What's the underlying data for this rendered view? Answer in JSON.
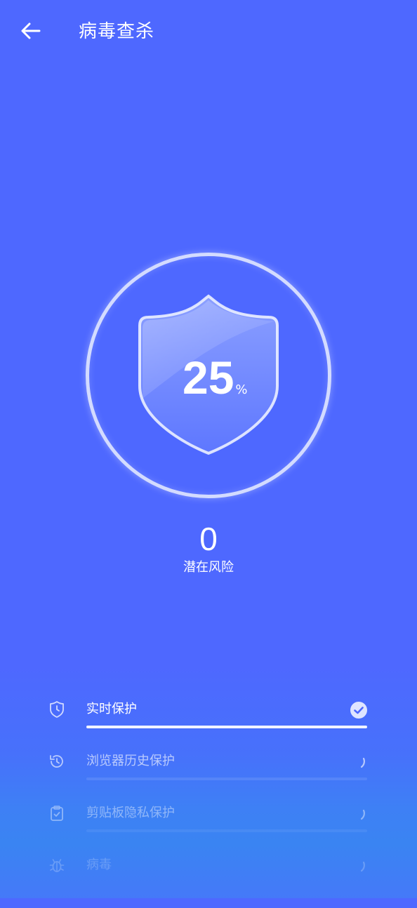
{
  "header": {
    "title": "病毒查杀",
    "back_icon": "arrow-left-icon"
  },
  "scan": {
    "progress": 25,
    "progress_value": "25",
    "unit": "%"
  },
  "risk": {
    "count": "0",
    "label": "潜在风险"
  },
  "colors": {
    "background": "#4e68ff",
    "accent": "#ffffff"
  },
  "items": [
    {
      "label": "实时保护",
      "icon": "clock-shield-icon",
      "status": "done",
      "status_icon": "check-circle-icon",
      "progress": 1.0
    },
    {
      "label": "浏览器历史保护",
      "icon": "history-icon",
      "status": "scanning",
      "status_icon": "spinner-icon",
      "progress": 0
    },
    {
      "label": "剪贴板隐私保护",
      "icon": "clipboard-icon",
      "status": "scanning",
      "status_icon": "spinner-icon",
      "progress": 0
    },
    {
      "label": "病毒",
      "icon": "bug-icon",
      "status": "scanning",
      "status_icon": "spinner-icon",
      "progress": 0
    }
  ]
}
